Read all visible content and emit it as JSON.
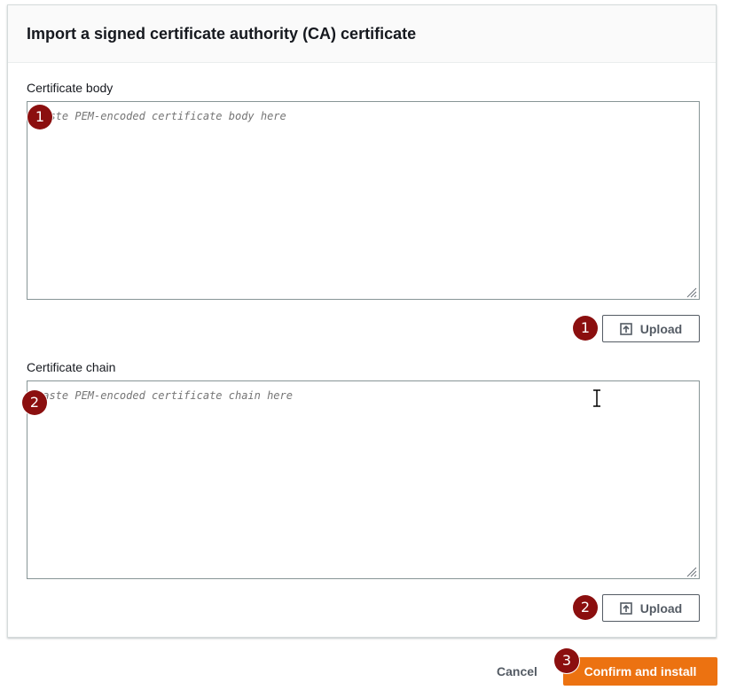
{
  "panel": {
    "title": "Import a signed certificate authority (CA) certificate"
  },
  "certificate_body": {
    "label": "Certificate body",
    "placeholder": "Paste PEM-encoded certificate body here",
    "value": "",
    "upload_label": "Upload",
    "upload_icon": "upload-icon"
  },
  "certificate_chain": {
    "label": "Certificate chain",
    "placeholder": "Paste PEM-encoded certificate chain here",
    "value": "",
    "upload_label": "Upload",
    "upload_icon": "upload-icon"
  },
  "markers": {
    "body_field": "1",
    "body_upload": "1",
    "chain_field": "2",
    "chain_upload": "2",
    "confirm": "3"
  },
  "footer": {
    "cancel_label": "Cancel",
    "confirm_label": "Confirm and install"
  },
  "colors": {
    "primary_button": "#ec7211",
    "marker": "#8b0f0f",
    "border": "#879596"
  }
}
